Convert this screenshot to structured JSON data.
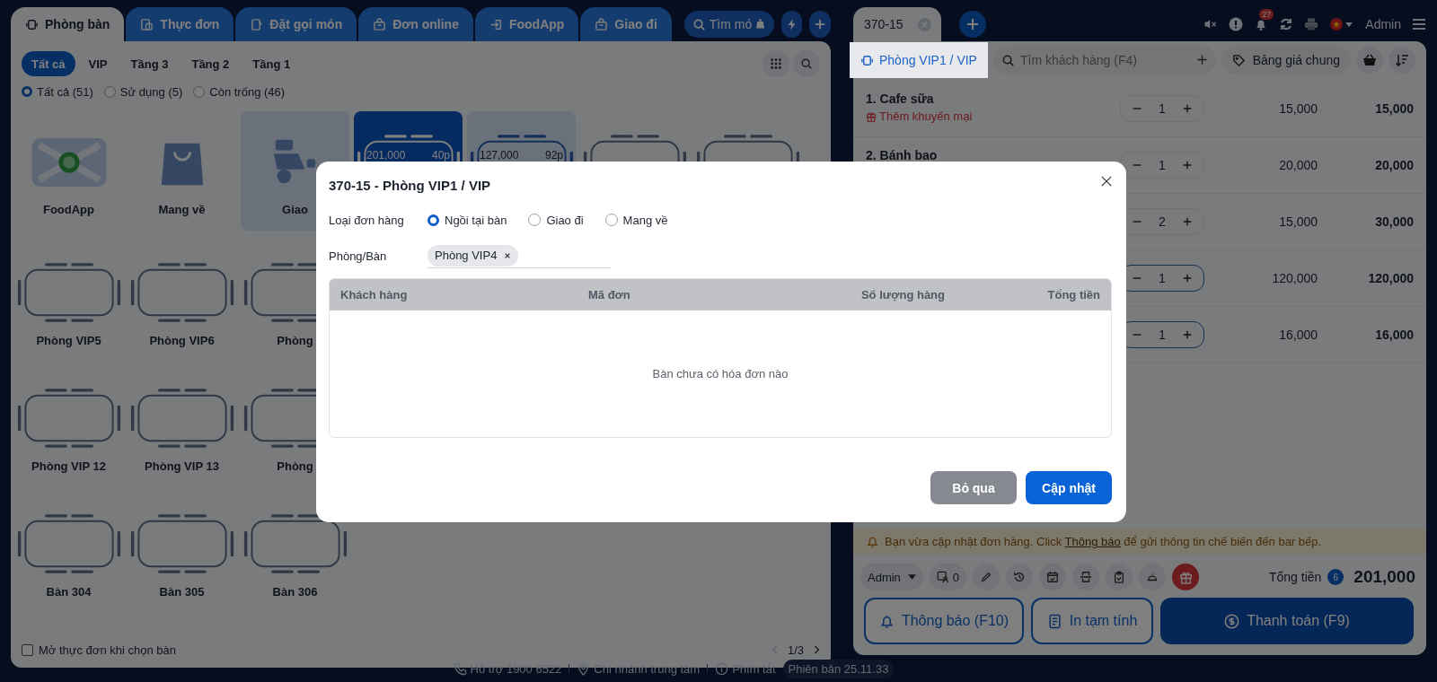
{
  "top_tabs": [
    {
      "label": "Phòng bàn",
      "kind": "tables",
      "selected": true
    },
    {
      "label": "Thực đơn",
      "kind": "menu",
      "selected": false
    },
    {
      "label": "Đặt gọi món",
      "kind": "order",
      "selected": false
    },
    {
      "label": "Đơn online",
      "kind": "bag",
      "selected": false
    },
    {
      "label": "FoodApp",
      "kind": "app",
      "selected": false
    },
    {
      "label": "Giao đi",
      "kind": "bag",
      "selected": false
    }
  ],
  "dish_search": {
    "placeholder": "Tìm mó"
  },
  "area_tabs": [
    {
      "label": "Tất cả",
      "selected": true
    },
    {
      "label": "VIP",
      "selected": false
    },
    {
      "label": "Tầng 3",
      "selected": false
    },
    {
      "label": "Tầng 2",
      "selected": false
    },
    {
      "label": "Tầng 1",
      "selected": false
    }
  ],
  "status_filters": [
    {
      "label": "Tất cả (51)",
      "selected": true
    },
    {
      "label": "Sử dụng (5)",
      "selected": false
    },
    {
      "label": "Còn trống (46)",
      "selected": false
    }
  ],
  "tile_rows": [
    [
      {
        "kind": "app",
        "label": "FoodApp",
        "selected": false
      },
      {
        "kind": "takeaway",
        "label": "Mang về",
        "selected": false
      },
      {
        "kind": "delivery",
        "label": "Giao",
        "selected": true
      },
      {
        "kind": "table",
        "selected": true,
        "in_use": true,
        "amount": "201,000",
        "duration": "40p"
      },
      {
        "kind": "table",
        "selected": false,
        "in_use": true,
        "amount": "127,000",
        "duration": "92p"
      },
      {
        "kind": "table",
        "selected": false,
        "in_use": false
      },
      {
        "kind": "table",
        "selected": false,
        "in_use": false
      }
    ],
    [
      {
        "kind": "table",
        "label": "Phòng VIP5",
        "selected": false,
        "in_use": false
      },
      {
        "kind": "table",
        "label": "Phòng VIP6",
        "selected": false,
        "in_use": false
      },
      {
        "kind": "table",
        "label": "Phòng",
        "selected": false,
        "in_use": false
      }
    ],
    [
      {
        "kind": "table",
        "label": "Phòng VIP 12",
        "selected": false,
        "in_use": false
      },
      {
        "kind": "table",
        "label": "Phòng VIP 13",
        "selected": false,
        "in_use": false
      },
      {
        "kind": "table",
        "label": "Phòng",
        "selected": false,
        "in_use": false
      }
    ],
    [
      {
        "kind": "table",
        "label": "Bàn 304",
        "selected": false,
        "in_use": false
      },
      {
        "kind": "table",
        "label": "Bàn 305",
        "selected": false,
        "in_use": false
      },
      {
        "kind": "table",
        "label": "Bàn 306",
        "selected": false,
        "in_use": false
      }
    ]
  ],
  "open_menu_option": {
    "label": "Mở thực đơn khi chọn bàn",
    "checked": false
  },
  "pager": {
    "page": "1/3"
  },
  "order_tab": {
    "label": "370-15"
  },
  "notifications_badge": "27",
  "user": "Admin",
  "order_toolbar": {
    "table": "Phòng VIP1 / VIP",
    "customer_search": {
      "placeholder": "Tìm khách hàng (F4)"
    },
    "price_list": "Bảng giá chung"
  },
  "order_items": [
    {
      "name": "1. Cafe sữa",
      "promo": "Thêm khuyến mại",
      "qty": "1",
      "price": "15,000",
      "total": "15,000",
      "highlighted": false
    },
    {
      "name": "2. Bánh bao",
      "qty": "1",
      "price": "20,000",
      "total": "20,000",
      "highlighted": false
    },
    {
      "qty": "2",
      "price": "15,000",
      "total": "30,000",
      "highlighted": false
    },
    {
      "qty": "1",
      "price": "120,000",
      "total": "120,000",
      "highlighted": true
    },
    {
      "qty": "1",
      "price": "16,000",
      "total": "16,000",
      "highlighted": true
    }
  ],
  "notice": {
    "before": "Bạn vừa cập nhật đơn hàng. Click ",
    "link": "Thông báo",
    "after": " để gửi thông tin chế biến đến bar bếp."
  },
  "staff": "Admin",
  "guest_count": "0",
  "total": {
    "label": "Tổng tiền",
    "count": "6",
    "amount": "201,000"
  },
  "actions": [
    {
      "label": "Thông báo (F10)",
      "kind": "notify"
    },
    {
      "label": "In tạm tính",
      "kind": "print"
    },
    {
      "label": "Thanh toán (F9)",
      "kind": "pay"
    }
  ],
  "status_bar": [
    {
      "label": "Hỗ trợ 1900 6522",
      "kind": "phone"
    },
    {
      "label": "Chi nhánh trung tâm",
      "kind": "location"
    },
    {
      "label": "Phím tắt",
      "kind": "info"
    },
    {
      "label": "Phiên bản 25.11.33",
      "kind": "version"
    }
  ],
  "dialog": {
    "title": "370-15 - Phòng VIP1 / VIP",
    "order_type": {
      "label": "Loại đơn hàng",
      "options": [
        {
          "label": "Ngồi tại bàn",
          "selected": true
        },
        {
          "label": "Giao đi",
          "selected": false
        },
        {
          "label": "Mang về",
          "selected": false
        }
      ]
    },
    "table_field": {
      "label": "Phòng/Bàn",
      "chips": [
        "Phòng VIP4"
      ]
    },
    "columns": [
      "Khách hàng",
      "Mã đơn",
      "Số lượng hàng",
      "Tổng tiền"
    ],
    "empty": "Bàn chưa có hóa đơn nào",
    "buttons": [
      {
        "label": "Bỏ qua",
        "kind": "secondary"
      },
      {
        "label": "Cập nhật",
        "kind": "primary"
      }
    ]
  }
}
